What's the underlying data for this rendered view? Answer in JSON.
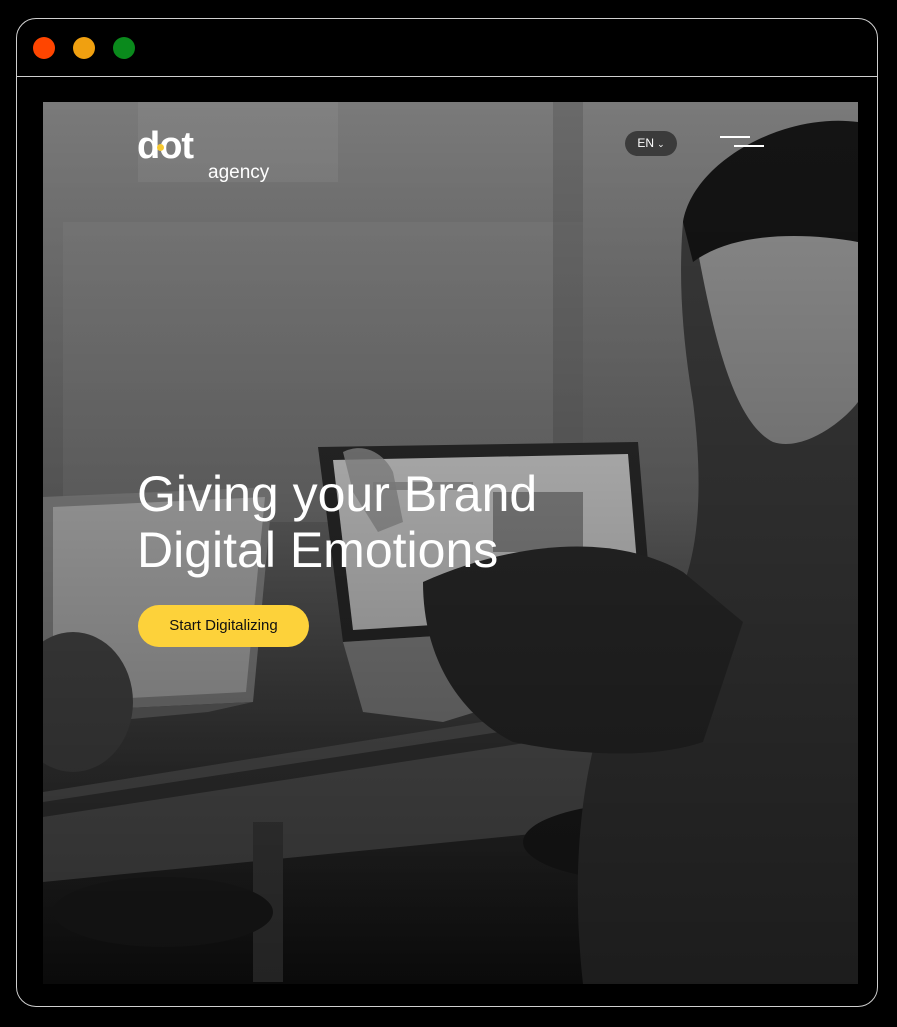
{
  "window": {
    "controls": [
      "close",
      "minimize",
      "maximize"
    ]
  },
  "brand": {
    "logo_main": "dot",
    "logo_sub": "agency",
    "accent_color": "#f6c830"
  },
  "nav": {
    "language": "EN",
    "language_icon": "chevron-down-icon",
    "menu_icon": "hamburger-icon"
  },
  "hero": {
    "headline_line1": "Giving your Brand",
    "headline_line2": "Digital Emotions",
    "cta_label": "Start Digitalizing",
    "cta_color": "#fdd23a",
    "background": "grayscale photo of a man at a desk with laptops"
  }
}
